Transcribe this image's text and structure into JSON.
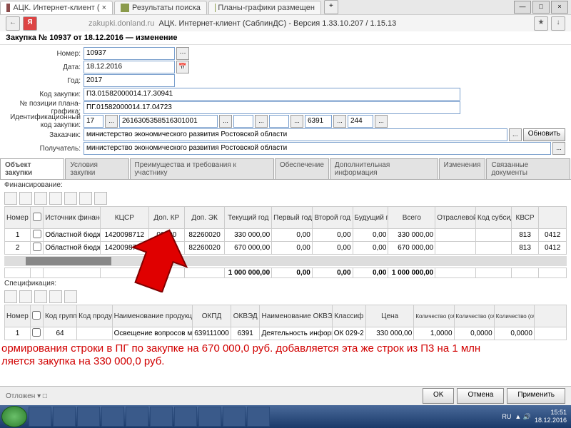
{
  "browser": {
    "tabs": [
      "АЦК. Интернет-клиент ( ×",
      "Результаты поиска",
      "Планы-графики размещен"
    ],
    "address_host": "zakupki.donland.ru",
    "address_rest": "АЦК. Интернет-клиент (СаблинДС) - Версия 1.33.10.207 / 1.15.13",
    "back": "←",
    "ya": "Я",
    "plus": "+",
    "minimize": "—",
    "maximize": "□",
    "close": "×",
    "down": "↓",
    "star": "★"
  },
  "doc": {
    "title": "Закупка № 10937 от 18.12.2016 — изменение",
    "labels": {
      "nomer": "Номер:",
      "data": "Дата:",
      "god": "Год:",
      "kod": "Код закупки:",
      "npos": "№ позиции плана-графика:",
      "idkod": "Идентификационный код закупки:",
      "zakaz": "Заказчик:",
      "poluch": "Получатель:"
    },
    "nomer": "10937",
    "data": "18.12.2016",
    "god": "2017",
    "kod": "П3.01582000014.17.30941",
    "npos": "ПГ.01582000014.17.04723",
    "idk1": "17",
    "idk2": "2616305358516301001",
    "idk3": "6391",
    "idk4": "244",
    "org": "министерство экономического развития Ростовской области",
    "obnovit": "Обновить",
    "ellipsis": "..."
  },
  "ptabs": [
    "Объект закупки",
    "Условия закупки",
    "Преимущества и требования к участнику",
    "Обеспечение",
    "Дополнительная информация",
    "Изменения",
    "Связанные документы"
  ],
  "fin": {
    "label": "Финансирование:",
    "cols": [
      "Номер строки",
      "",
      "Источник финансирования",
      "КЦСР",
      "Доп. КР",
      "Доп. ЭК",
      "Текущий год",
      "Первый год",
      "Второй год",
      "Будущий период",
      "Всего",
      "Отраслевой код",
      "Код субсидии",
      "КВСР",
      ""
    ],
    "rows": [
      [
        "1",
        "",
        "Областной бюдже",
        "1420098712",
        "00000",
        "82260020",
        "330 000,00",
        "0,00",
        "0,00",
        "0,00",
        "330 000,00",
        "",
        "",
        "813",
        "0412"
      ],
      [
        "2",
        "",
        "Областной бюдже",
        "1420098715",
        "",
        "82260020",
        "670 000,00",
        "0,00",
        "0,00",
        "0,00",
        "670 000,00",
        "",
        "",
        "813",
        "0412"
      ]
    ],
    "totals": [
      "",
      "",
      "",
      "",
      "",
      "",
      "1 000 000,00",
      "0,00",
      "0,00",
      "0,00",
      "1 000 000,00",
      "",
      "",
      "",
      ""
    ]
  },
  "spec": {
    "label": "Спецификация:",
    "cols": [
      "Номер строки",
      "",
      "Код группы",
      "Код продукции",
      "Наименование продукции",
      "ОКПД",
      "ОКВЭД",
      "Наименование ОКВЭД",
      "Классиф",
      "Цена",
      "Количество (объем) планируемых к закупке товаров, работ, услуг: Текущий год",
      "Количество (объем) планируемых к закупке товаров, работ, услуг: Первый год",
      "Количество (объем) планируемых к закупке товаров, работ, услуг: Второй год",
      ""
    ],
    "row": [
      "1",
      "",
      "64",
      "",
      "Освещение вопросов мало",
      "639111000",
      "6391",
      "Деятельность информацио",
      "ОК 029-2",
      "",
      "330 000,00",
      "1,0000",
      "0,0000",
      "0,0000"
    ]
  },
  "annot": {
    "l1": "ормирования строки в ПГ по закупке на 670 000,0 руб. добавляется эта же строк из П3 на 1 млн",
    "l2": "ляется закупка на 330 000,0 руб."
  },
  "footer": {
    "left": "Отложен ▾   □",
    "ok": "OK",
    "cancel": "Отмена",
    "apply": "Применить"
  },
  "tray": {
    "lang": "RU",
    "time": "15:51",
    "date": "18.12.2016"
  }
}
